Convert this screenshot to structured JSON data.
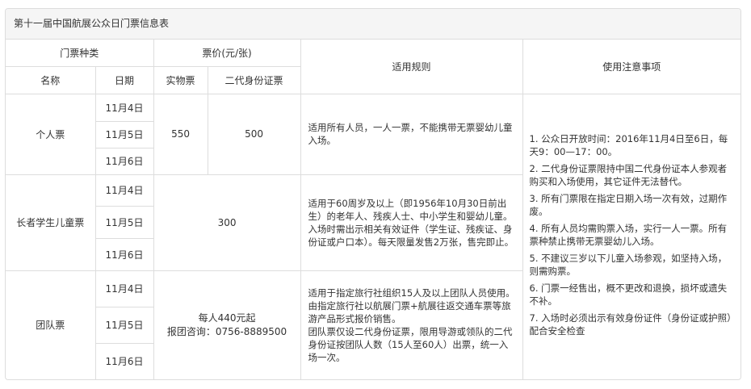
{
  "panel": {
    "title": "第十一届中国航展公众日门票信息表"
  },
  "header": {
    "ticket_type": "门票种类",
    "price": "票价(元/张)",
    "rules": "适用规则",
    "notes": "使用注意事项",
    "name": "名称",
    "date": "日期",
    "physical": "实物票",
    "id_card": "二代身份证票"
  },
  "rows": [
    {
      "name": "个人票",
      "dates": [
        "11月4日",
        "11月5日",
        "11月6日"
      ],
      "physical_price": "550",
      "id_price": "500",
      "rules": [
        "适用所有人员，一人一票，不能携带无票婴幼儿童入场。"
      ]
    },
    {
      "name": "长者学生儿童票",
      "dates": [
        "11月4日",
        "11月5日",
        "11月6日"
      ],
      "price": "300",
      "rules": [
        "适用于60周岁及以上（即1956年10月30日前出生）的老年人、残疾人士、中小学生和婴幼儿童。",
        "入场时需出示相关有效证件（学生证、残疾证、身份证或户口本）。每天限量发售2万张，售完即止。"
      ]
    },
    {
      "name": "团队票",
      "dates": [
        "11月4日",
        "11月5日",
        "11月6日"
      ],
      "price_lines": [
        "每人440元起",
        "报团咨询：0756-8889500"
      ],
      "rules": [
        "适用于指定旅行社组织15人及以上团队人员使用。",
        "由指定旅行社以航展门票+航展往返交通车票等旅游产品形式报价销售。",
        "团队票仅设二代身份证票，限用导游或领队的二代身份证按团队人数（15人至60人）出票，统一入场一次。"
      ]
    }
  ],
  "notes": [
    "1. 公众日开放时间：2016年11月4日至6日，每天9：00—17：00。",
    "2. 二代身份证票限持中国二代身份证本人参观者购买和入场使用，其它证件无法替代。",
    "3. 所有门票限在指定日期入场一次有效，过期作废。",
    "4. 所有人员均需购票入场，实行一人一票。所有票种禁止携带无票婴幼儿入场。",
    "5. 不建议三岁以下儿童入场参观，如坚持入场，则需购票。",
    "6. 门票一经售出，概不更改和退换，损坏或遗失不补。",
    "7. 入场时必须出示有效身份证件（身份证或护照）配合安全检查"
  ]
}
